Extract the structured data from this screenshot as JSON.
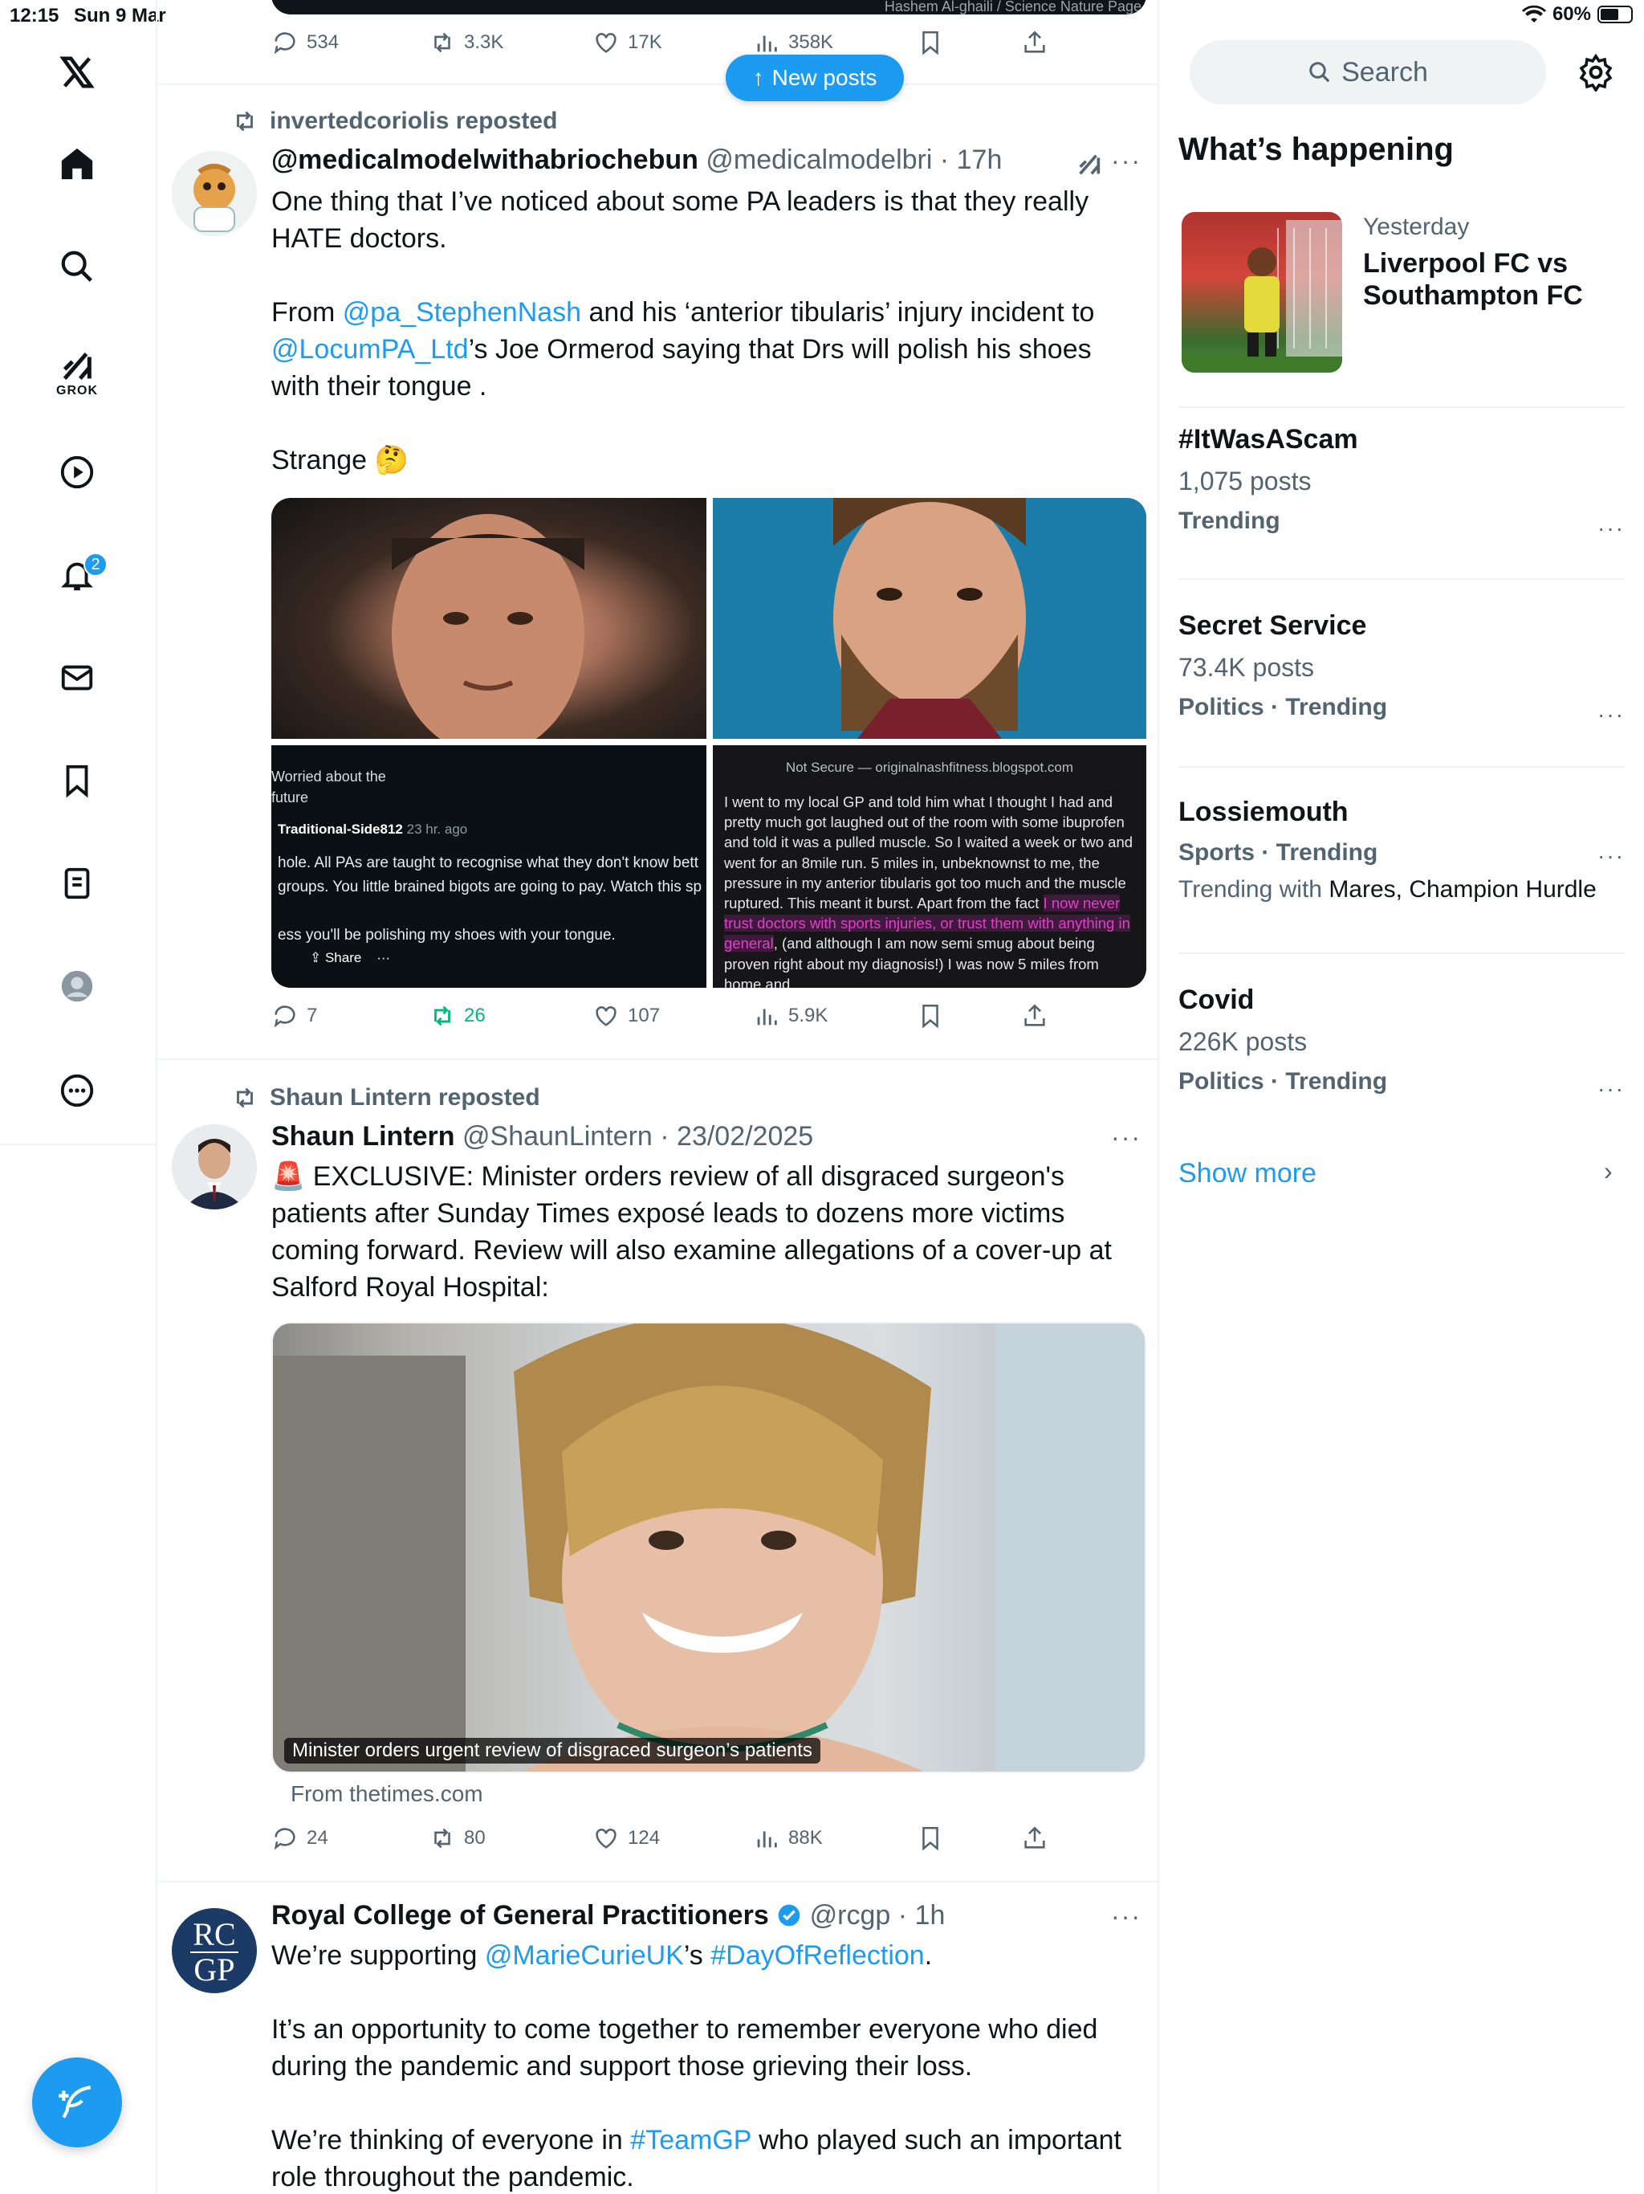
{
  "status_bar": {
    "time": "12:15",
    "date": "Sun 9 Mar",
    "battery": "60%"
  },
  "nav": {
    "grok_label": "GROK",
    "notifications_count": "2"
  },
  "new_posts_label": "New posts",
  "top_post": {
    "media_caption": "Hashem Al-ghaili / Science Nature Page",
    "replies": "534",
    "reposts": "3.3K",
    "likes": "17K",
    "views": "358K"
  },
  "post1": {
    "repost_by": "invertedcoriolis reposted",
    "name": "@medicalmodelwithabriochebun",
    "handle": "@medicalmodelbri",
    "time": "17h",
    "text_line1": "One thing that I’ve noticed about some PA leaders is that they really HATE doctors.",
    "text_pre": "From ",
    "mention1": "@pa_StephenNash",
    "text_mid": " and his ‘anterior tibularis’ injury incident to ",
    "mention2": "@LocumPA_Ltd",
    "text_post": "’s Joe Ormerod saying that Drs will polish his shoes with their tongue .",
    "text_last": "Strange 🤔",
    "reddit": {
      "line1": "Worried about the",
      "line2": "future",
      "user": "Traditional-Side812",
      "ago": "23 hr. ago",
      "comment1": "hole. All PAs are taught to recognise what they don't know bett",
      "comment2": "groups. You little brained bigots are going to pay. Watch this sp",
      "comment3": "ess you'll be polishing my shoes with your tongue.",
      "share": "Share"
    },
    "blog": {
      "bar": "Not Secure — originalnashfitness.blogspot.com",
      "text1": "I went to my local GP and told him what I thought I had and pretty much got laughed out of the room with some ibuprofen and told it was a pulled muscle. So I waited a week or two and went for an 8mile run. 5 miles in, unbeknownst to me, the pressure in my anterior tibularis got too much and the muscle ruptured. This meant it burst. Apart from the fact ",
      "highlight": "I now never trust doctors with sports injuries, or trust them with anything in general",
      "text2": ", (and although I am now semi smug about being proven right about my diagnosis!) I was now 5 miles from home and"
    },
    "replies": "7",
    "reposts": "26",
    "likes": "107",
    "views": "5.9K"
  },
  "post2": {
    "repost_by": "Shaun Lintern reposted",
    "name": "Shaun Lintern",
    "handle": "@ShaunLintern",
    "time": "23/02/2025",
    "text": "🚨 EXCLUSIVE: Minister orders review of all disgraced surgeon's patients after Sunday Times exposé leads to dozens more victims coming forward. Review will also examine allegations of a cover-up at Salford Royal Hospital:",
    "card_caption": "Minister orders urgent review of disgraced surgeon’s patients",
    "card_source": "From thetimes.com",
    "replies": "24",
    "reposts": "80",
    "likes": "124",
    "views": "88K"
  },
  "post3": {
    "name": "Royal College of General Practitioners",
    "handle": "@rcgp",
    "time": "1h",
    "avatar_text_top": "RC",
    "avatar_text_bottom": "GP",
    "line1_pre": "We’re supporting ",
    "mention": "@MarieCurieUK",
    "line1_mid": "’s ",
    "hashtag1": "#DayOfReflection",
    "line1_end": ".",
    "para2": "It’s an opportunity to come together to remember everyone who died during the pandemic and support those grieving their loss.",
    "para3_pre": "We’re thinking of everyone in ",
    "hashtag2": "#TeamGP",
    "para3_post": " who played such an important role throughout the pandemic."
  },
  "sidebar": {
    "search_placeholder": "Search",
    "title": "What’s happening",
    "featured": {
      "when": "Yesterday",
      "title": "Liverpool FC vs Southampton FC"
    },
    "trends": [
      {
        "topic": "#ItWasAScam",
        "posts": "1,075 posts",
        "category": "Trending"
      },
      {
        "topic": "Secret Service",
        "posts": "73.4K posts",
        "category": "Politics · Trending"
      },
      {
        "category": "Sports · Trending",
        "topic": "Lossiemouth",
        "with_pre": "Trending with ",
        "with": "Mares, Champion Hurdle"
      },
      {
        "topic": "Covid",
        "posts": "226K posts",
        "category": "Politics · Trending"
      }
    ],
    "show_more": "Show more"
  }
}
